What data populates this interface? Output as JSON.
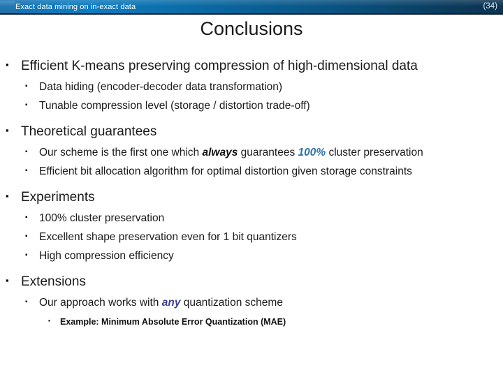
{
  "header": {
    "banner_title": "Exact data mining on in-exact data",
    "page_number": "(34)",
    "accent_color": "#0e7cc0",
    "banner_text_color": "#ffffff"
  },
  "slide": {
    "title": "Conclusions"
  },
  "bullets": {
    "marker_glyph": "▪",
    "section1": {
      "heading": "Efficient K-means preserving compression of high-dimensional data",
      "items": [
        "Data hiding (encoder-decoder data transformation)",
        "Tunable compression level (storage / distortion trade-off)"
      ]
    },
    "section2": {
      "heading": "Theoretical guarantees",
      "item1": {
        "part1": "Our scheme is the first one which ",
        "emph_always": "always",
        "part2": " guarantees ",
        "emph_percent": "100%",
        "part3": " cluster preservation"
      },
      "item2": "Efficient bit allocation algorithm for optimal distortion given storage constraints"
    },
    "section3": {
      "heading": "Experiments",
      "items": [
        "100% cluster preservation",
        "Excellent shape preservation even for 1 bit quantizers",
        "High compression efficiency"
      ]
    },
    "section4": {
      "heading": "Extensions",
      "item1": {
        "part1": "Our approach works with ",
        "emph_any": "any",
        "part2": " quantization scheme"
      },
      "subitem": "Example: Minimum Absolute Error Quantization (MAE)"
    }
  },
  "colors": {
    "emphasis_blue": "#2e74a8",
    "emphasis_purple": "#3f3f8f",
    "text_dark": "#1a1a1a"
  }
}
